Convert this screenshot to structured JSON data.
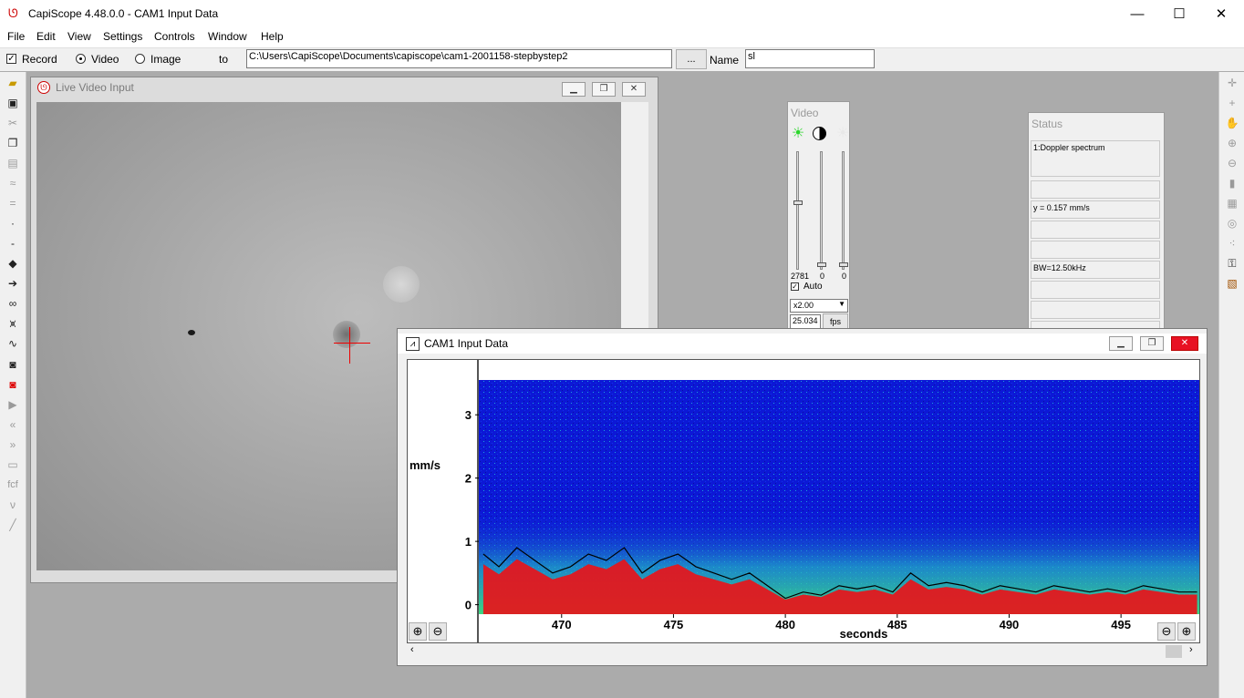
{
  "window": {
    "title": "CapiScope 4.48.0.0 - CAM1 Input Data",
    "min": "—",
    "max": "☐",
    "close": "✕"
  },
  "menu": [
    "File",
    "Edit",
    "View",
    "Settings",
    "Controls",
    "Window",
    "Help"
  ],
  "options": {
    "record_label": "Record",
    "video_label": "Video",
    "image_label": "Image",
    "to_label": "to",
    "path_value": "C:\\Users\\CapiScope\\Documents\\capiscope\\cam1-2001158-stepbystep2",
    "browse_label": "...",
    "name_label": "Name",
    "name_value": "sl"
  },
  "live_video": {
    "title": "Live Video Input"
  },
  "video_panel": {
    "title": "Video",
    "values": [
      "2781",
      "0",
      "0"
    ],
    "auto_label": "Auto",
    "zoom_value": "x2.00",
    "fps_value": "25.034",
    "fps_label": "fps"
  },
  "status_panel": {
    "title": "Status",
    "rows": [
      "1:Doppler spectrum",
      "",
      "y = 0.157 mm/s",
      "",
      "",
      "BW=12.50kHz",
      "",
      "",
      ""
    ]
  },
  "cam1": {
    "title": "CAM1 Input Data",
    "y_label": "mm/s",
    "x_label": "seconds",
    "y_ticks": [
      "3",
      "2",
      "1",
      "0"
    ],
    "x_ticks": [
      "470",
      "475",
      "480",
      "485",
      "490",
      "495"
    ]
  },
  "chart_data": {
    "type": "heatmap",
    "title": "",
    "xlabel": "seconds",
    "ylabel": "mm/s",
    "xlim": [
      466.3,
      498.5
    ],
    "ylim": [
      -0.15,
      3.55
    ],
    "x_ticks": [
      470,
      475,
      480,
      485,
      490,
      495
    ],
    "y_ticks": [
      0,
      1,
      2,
      3
    ],
    "envelope": {
      "x": [
        466.5,
        467.2,
        468,
        468.8,
        469.6,
        470.4,
        471.2,
        472,
        472.8,
        473.6,
        474.4,
        475.2,
        476,
        476.8,
        477.6,
        478.4,
        479.2,
        480,
        480.8,
        481.6,
        482.4,
        483.2,
        484,
        484.8,
        485.6,
        486.4,
        487.2,
        488,
        488.8,
        489.6,
        490.4,
        491.2,
        492,
        492.8,
        493.6,
        494.4,
        495.2,
        496,
        496.8,
        497.6,
        498.4
      ],
      "y": [
        0.8,
        0.6,
        0.9,
        0.7,
        0.5,
        0.6,
        0.8,
        0.7,
        0.9,
        0.5,
        0.7,
        0.8,
        0.6,
        0.5,
        0.4,
        0.5,
        0.3,
        0.1,
        0.2,
        0.15,
        0.3,
        0.25,
        0.3,
        0.2,
        0.5,
        0.3,
        0.35,
        0.3,
        0.2,
        0.3,
        0.25,
        0.2,
        0.3,
        0.25,
        0.2,
        0.25,
        0.2,
        0.3,
        0.25,
        0.2,
        0.2
      ]
    },
    "colors": {
      "background": "#0b16d8",
      "mid": "#22c7c8",
      "low": "#e8141a",
      "envelope": "#000000"
    }
  }
}
